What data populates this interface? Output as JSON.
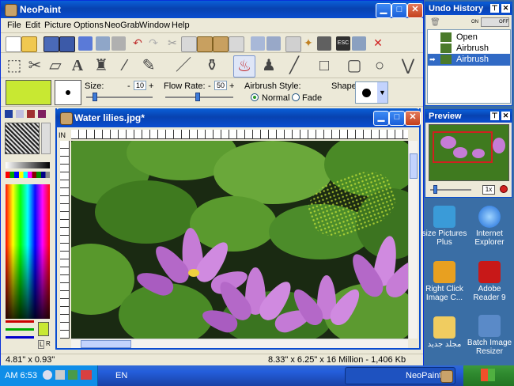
{
  "main_window": {
    "title": "NeoPaint",
    "menu": [
      "File",
      "Edit",
      "Picture",
      "Options",
      "NeoGrab",
      "Window",
      "Help"
    ],
    "options": {
      "size_label": "Size:",
      "size_value": "10",
      "flow_label": "Flow Rate:",
      "flow_value": "50",
      "airbrush_label": "Airbrush Style:",
      "normal_label": "Normal",
      "fade_label": "Fade",
      "shape_label": "Shape:",
      "minus": "-",
      "plus": "+"
    },
    "status_left": "4.81\" x 0.93\"",
    "status_right": "8.33\" x 6.25\" x 16 Million - 1,406 Kb"
  },
  "document": {
    "title": "Water lilies.jpg*",
    "ruler_unit": "IN"
  },
  "undo_panel": {
    "title": "Undo History",
    "toggle_on": "ON",
    "toggle_off": "OFF",
    "items": [
      "Open",
      "Airbrush",
      "Airbrush"
    ],
    "selected_index": 2
  },
  "preview_panel": {
    "title": "Preview",
    "zoom": "1x"
  },
  "left_panel": {
    "l_label": "L",
    "r_label": "R"
  },
  "desktop_icons": [
    {
      "label": "size Pictures Plus",
      "icon": "resize-pictures-icon"
    },
    {
      "label": "Internet Explorer",
      "icon": "internet-explorer-icon"
    },
    {
      "label": "Right Click Image C...",
      "icon": "right-click-image-icon"
    },
    {
      "label": "Adobe Reader 9",
      "icon": "adobe-reader-icon"
    },
    {
      "label": "مجلد جديد",
      "icon": "folder-icon"
    },
    {
      "label": "Batch Image Resizer",
      "icon": "batch-image-resizer-icon"
    }
  ],
  "taskbar": {
    "clock": "AM 6:53",
    "lang": "EN",
    "app_button": "NeoPaint"
  },
  "colors": {
    "title_blue": "#0842b0",
    "canvas_green": "#3f7a1f",
    "lily_pink": "#c67cd6",
    "selection_blue": "#316ac5"
  }
}
